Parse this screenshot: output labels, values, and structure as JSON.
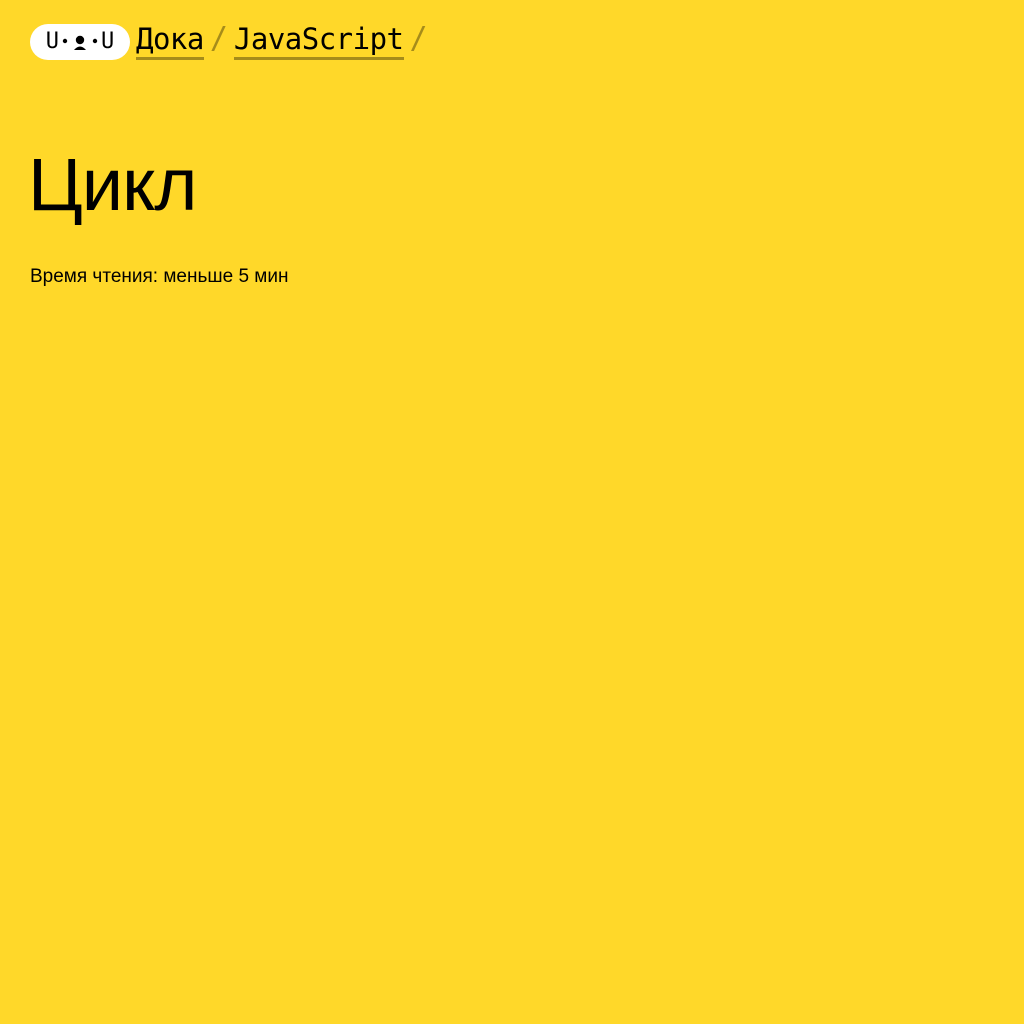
{
  "logo": {
    "left": "U",
    "face": "•ᴥ•",
    "right": "U",
    "background": "#ffffff"
  },
  "breadcrumb": {
    "items": [
      {
        "label": "Дока"
      },
      {
        "label": "JavaScript"
      }
    ],
    "separator": "/"
  },
  "page": {
    "title": "Цикл",
    "reading_time": "Время чтения: меньше 5 мин",
    "background": "#ffd829"
  }
}
